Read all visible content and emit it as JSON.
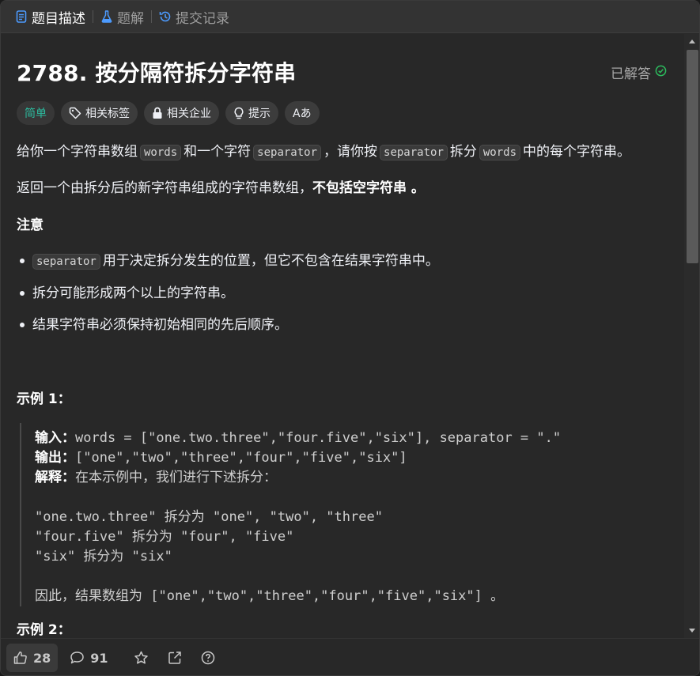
{
  "tabs": [
    {
      "label": "题目描述",
      "icon": "document-icon",
      "active": true
    },
    {
      "label": "题解",
      "icon": "flask-icon",
      "active": false
    },
    {
      "label": "提交记录",
      "icon": "history-icon",
      "active": false
    }
  ],
  "problem": {
    "title": "2788. 按分隔符拆分字符串",
    "status": "已解答",
    "tags": [
      "简单",
      "相关标签",
      "相关企业",
      "提示",
      "Aあ"
    ],
    "desc1": {
      "a": "给你一个字符串数组",
      "code1": "words",
      "b": "和一个字符",
      "code2": "separator",
      "c": "，请你按",
      "code3": "separator",
      "d": "拆分",
      "code4": "words",
      "e": "中的每个字符串。"
    },
    "desc2": {
      "a": "返回一个由拆分后的新字符串组成的字符串数组，",
      "bold": "不包括空字符串",
      "b": " 。"
    },
    "note_heading": "注意",
    "notes": [
      {
        "code": "separator",
        "text": "用于决定拆分发生的位置，但它不包含在结果字符串中。"
      },
      {
        "code": "",
        "text": "拆分可能形成两个以上的字符串。"
      },
      {
        "code": "",
        "text": "结果字符串必须保持初始相同的先后顺序。"
      }
    ],
    "example1_heading": "示例 1：",
    "example1": {
      "input_label": "输入：",
      "input_value": "words = [\"one.two.three\",\"four.five\",\"six\"], separator = \".\"",
      "output_label": "输出：",
      "output_value": "[\"one\",\"two\",\"three\",\"four\",\"five\",\"six\"]",
      "explain_label": "解释：",
      "explain_value": "在本示例中，我们进行下述拆分：",
      "lines": [
        {
          "a": "\"one.two.three\" ",
          "cn": "拆分为",
          "b": " \"one\", \"two\", \"three\""
        },
        {
          "a": "\"four.five\" ",
          "cn": "拆分为",
          "b": " \"four\", \"five\""
        },
        {
          "a": "\"six\" ",
          "cn": "拆分为",
          "b": " \"six\""
        }
      ],
      "conclusion_cn": "因此，结果数组为",
      "conclusion_code": " [\"one\",\"two\",\"three\",\"four\",\"five\",\"six\"] 。"
    },
    "example2_heading": "示例 2："
  },
  "footer": {
    "likes": "28",
    "comments": "91"
  },
  "colors": {
    "easy": "#2cbb9f",
    "solved_check": "#2cbb5d",
    "tab_active_icon": "#4c9bff"
  }
}
